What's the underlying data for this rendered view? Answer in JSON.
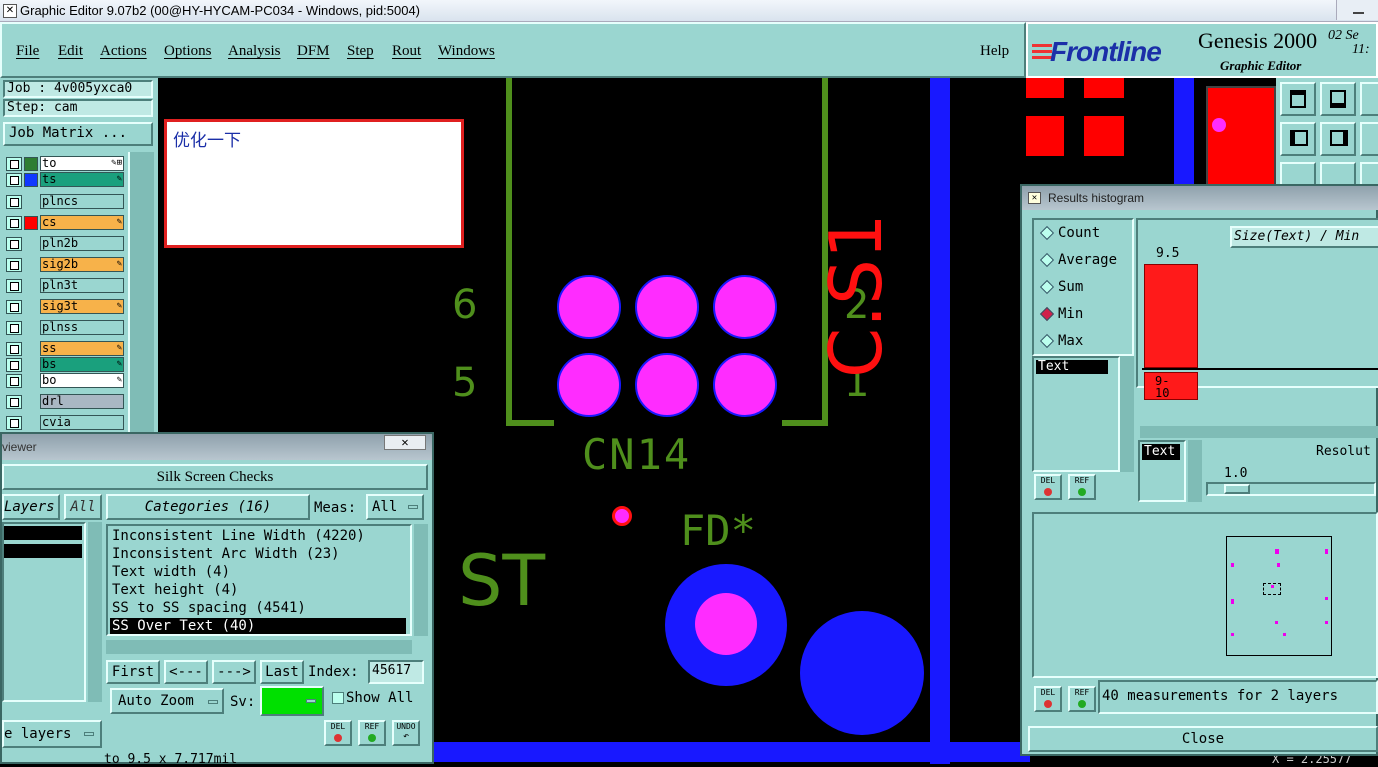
{
  "window": {
    "title": "Graphic Editor 9.07b2 (00@HY-HYCAM-PC034 - Windows, pid:5004)"
  },
  "menu": [
    "File",
    "Edit",
    "Actions",
    "Options",
    "Analysis",
    "DFM",
    "Step",
    "Rout",
    "Windows"
  ],
  "help": "Help",
  "brand": {
    "logo": "Frontline",
    "product": "Genesis 2000",
    "subtitle": "Graphic Editor",
    "date_fragment": "02  Se",
    "time_fragment": "11:"
  },
  "job": {
    "job_label": "Job : 4v005yxca0",
    "step_label": "Step: cam",
    "matrix_button": "Job Matrix ..."
  },
  "layers": [
    {
      "name": "to",
      "color": "#ffffff",
      "swatch": "#2e7d32",
      "mark": "✎⊞"
    },
    {
      "name": "ts",
      "color": "#1aa07d",
      "swatch": "#1038ff",
      "mark": "✎"
    },
    {
      "name": "plncs",
      "color": "#9ad6d0",
      "swatch": "",
      "mark": ""
    },
    {
      "name": "cs",
      "color": "#f7b24a",
      "swatch": "#ff0000",
      "mark": "✎"
    },
    {
      "name": "pln2b",
      "color": "#9ad6d0",
      "swatch": "",
      "mark": ""
    },
    {
      "name": "sig2b",
      "color": "#f7b24a",
      "swatch": "",
      "mark": "✎"
    },
    {
      "name": "pln3t",
      "color": "#9ad6d0",
      "swatch": "",
      "mark": ""
    },
    {
      "name": "sig3t",
      "color": "#f7b24a",
      "swatch": "",
      "mark": "✎"
    },
    {
      "name": "plnss",
      "color": "#9ad6d0",
      "swatch": "",
      "mark": ""
    },
    {
      "name": "ss",
      "color": "#f7b24a",
      "swatch": "",
      "mark": "✎"
    },
    {
      "name": "bs",
      "color": "#1aa07d",
      "swatch": "",
      "mark": "✎"
    },
    {
      "name": "bo",
      "color": "#ffffff",
      "swatch": "",
      "mark": "✎"
    },
    {
      "name": "drl",
      "color": "#a9b7c3",
      "swatch": "",
      "mark": ""
    },
    {
      "name": "cvia",
      "color": "#9ad6d0",
      "swatch": "",
      "mark": ""
    }
  ],
  "note": {
    "text": "优化一下"
  },
  "canvas_labels": {
    "pin6": "6",
    "pin5": "5",
    "pin2": "2",
    "pin1": "1",
    "ref": "CN14",
    "fd": "FD*",
    "st": "ST",
    "red_text": "C.S1"
  },
  "viewer": {
    "title_fragment": "viewer",
    "header": "Silk Screen Checks",
    "layers_label": "Layers",
    "all_label": "All",
    "categories_label": "Categories (16)",
    "meas_label": "Meas:",
    "meas_value": "All",
    "categories": [
      "Inconsistent Line Width (4220)",
      "Inconsistent Arc Width (23)",
      "Text width (4)",
      "Text height (4)",
      "SS to SS spacing (4541)",
      "SS Over Text (40)"
    ],
    "selected_index": 5,
    "nav": {
      "first": "First",
      "prev": "<---",
      "next": "--->",
      "last": "Last",
      "index_label": "Index:",
      "index_value": "45617"
    },
    "auto_zoom": "Auto Zoom",
    "sv_label": "Sv:",
    "show_all": "Show All",
    "layers_menu": "e layers",
    "status": "to 9.5 x 7.717mil",
    "sv_color": "#00e000"
  },
  "histogram": {
    "title": "Results histogram",
    "options": [
      "Count",
      "Average",
      "Sum",
      "Min",
      "Max"
    ],
    "selected": "Min",
    "metric_label": "Size(Text) / Min",
    "bar_value_label": "9.5",
    "bar_range_label": "9-\n10",
    "list_item": "Text",
    "text_button": "Text",
    "resolution_label": "Resolut",
    "resolution_value": "1.0",
    "summary": "40 measurements for 2 layers",
    "close": "Close",
    "chart_data": {
      "type": "bar",
      "categories": [
        "9-10"
      ],
      "values": [
        40
      ],
      "value_labels": [
        "9.5"
      ]
    }
  },
  "buttons": {
    "del": "DEL",
    "ref": "REF",
    "undo": "UNDO"
  },
  "bottom_right": "X = 2.25577"
}
